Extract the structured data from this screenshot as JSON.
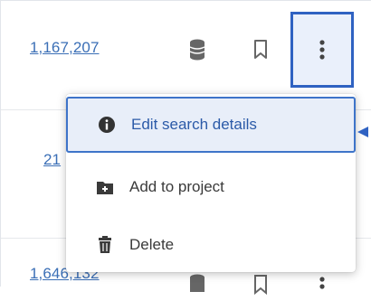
{
  "rows": [
    {
      "count": "1,167,207"
    },
    {
      "count": "21"
    },
    {
      "count": "1,646,132"
    }
  ],
  "row_icons": [
    "database-icon",
    "bookmark-icon",
    "more-vertical-icon"
  ],
  "menu": {
    "items": [
      {
        "label": "Edit search details",
        "icon": "info-circle-icon",
        "active": true
      },
      {
        "label": "Add to project",
        "icon": "folder-plus-icon",
        "active": false
      },
      {
        "label": "Delete",
        "icon": "trash-icon",
        "active": false
      }
    ]
  },
  "colors": {
    "link": "#3b6fb6",
    "highlight_border": "#2f62c2",
    "active_bg": "#e8eef9",
    "icon": "#5f6368"
  }
}
